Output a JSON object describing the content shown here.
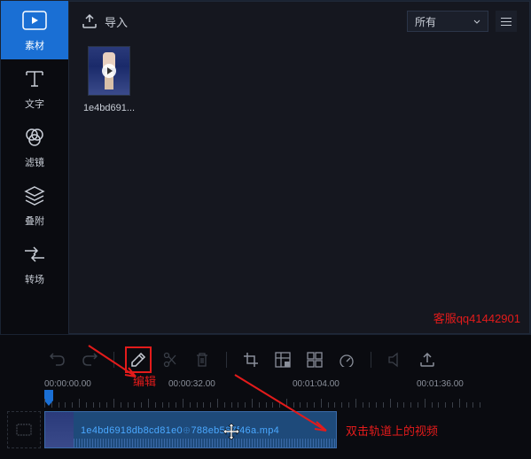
{
  "sidebar": {
    "items": [
      {
        "label": "素材",
        "name": "sidebar-item-media"
      },
      {
        "label": "文字",
        "name": "sidebar-item-text"
      },
      {
        "label": "滤镜",
        "name": "sidebar-item-filter"
      },
      {
        "label": "叠附",
        "name": "sidebar-item-overlay"
      },
      {
        "label": "转场",
        "name": "sidebar-item-transition"
      }
    ]
  },
  "header": {
    "import_label": "导入",
    "dropdown_selected": "所有"
  },
  "media": {
    "clip_name": "1e4bd691..."
  },
  "watermark": "客服qq41442901",
  "toolbar": {
    "edit_annotation": "编辑"
  },
  "ruler": {
    "labels": [
      "00:00:00.00",
      "00:00:32.00",
      "00:01:04.00",
      "00:01:36.00"
    ]
  },
  "track": {
    "clip_filename": "1e4bd6918db8cd81e0",
    "clip_filename_suffix": "788eb567f46a.mp4",
    "dbl_annotation": "双击轨道上的视频"
  }
}
